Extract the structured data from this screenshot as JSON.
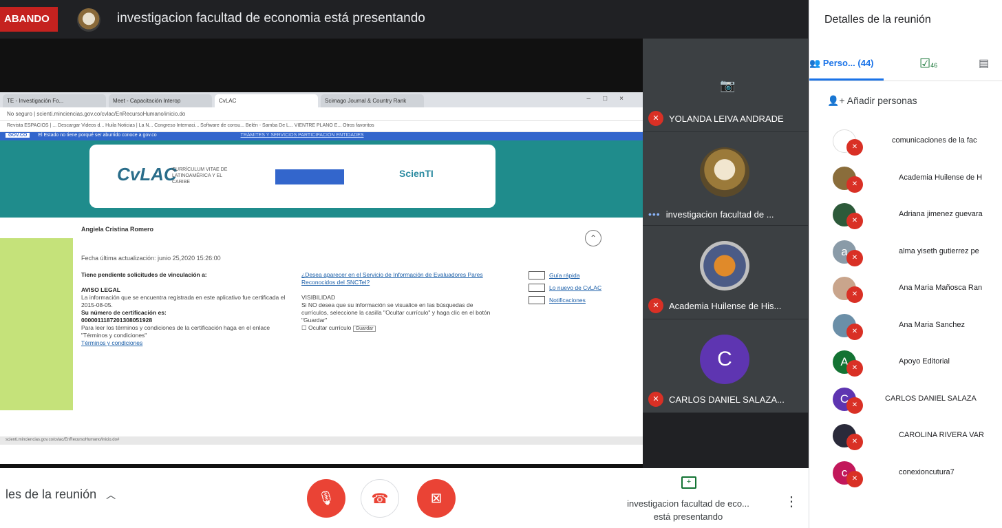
{
  "topbar": {
    "recording_label": "ABANDO",
    "presenter_text": "investigacion facultad de economia está presentando"
  },
  "browser": {
    "tabs": [
      "TE - Investigación Fo...",
      "Meet - Capacitación Interop",
      "CvLAC",
      "Scimago Journal & Country Rank"
    ],
    "address": "No seguro | scienti.minciencias.gov.co/cvlac/EnRecursoHumano/inicio.do",
    "bookmarks": "Revista ESPACIOS | ...  Descargar Videos d...  Huila Noticias | La N...  Congreso Internaci...  Software de consu...  Belén - Samba De L...  VIENTRE PLANO E...  Otros favoritos",
    "gov_label": "GOV.CO",
    "gov_note": "El Estado no tiene porqué ser aburrido conoce a gov.co",
    "gov_links": "TRÁMITES Y SERVICIOS   PARTICIPACIÓN   ENTIDADES",
    "cvlac_logo": "CvLAC",
    "cvlac_sub": "CURRÍCULUM VITAE DE LATINOAMÉRICA Y EL CARIBE",
    "scienti": "ScienTI",
    "person_name": "Angiela Cristina Romero",
    "last_update": "Fecha última actualización: junio 25,2020 15:26:00",
    "pending": "Tiene pendiente solicitudes de vinculación a:",
    "legal_title": "AVISO LEGAL",
    "legal_text": "La información que se encuentra registrada en este aplicativo fue certificada el 2015-08-05.",
    "cert_label": "Su número de certificación es:",
    "cert_number": "0000011187201308051928",
    "terms_text": "Para leer los términos y condiciones de la certificación haga en el enlace \"Términos y condiciones\"",
    "terms_link": "Términos y condiciones",
    "question_link": "¿Desea aparecer en el Servicio de Información de Evaluadores Pares Reconocidos del SNCTeI?",
    "visibility_title": "VISIBILIDAD",
    "visibility_text": "Si NO desea que su información se visualice en las búsquedas de currículos, seleccione la casilla \"Ocultar currículo\" y haga clic en el botón \"Guardar\"",
    "hide_label": "Ocultar currículo",
    "save_btn": "Guardar",
    "quick_guide": "Guía rápida",
    "news": "Lo nuevo de CvLAC",
    "notifications": "Notificaciones",
    "status_url": "scienti.minciencias.gov.co/cvlac/EnRecursoHumano/inicio.do#"
  },
  "tiles": [
    {
      "name": "YOLANDA LEIVA ANDRADE"
    },
    {
      "name": "investigacion facultad de ..."
    },
    {
      "name": "Academia Huilense de His..."
    },
    {
      "name": "CARLOS DANIEL SALAZA...",
      "initial": "C"
    }
  ],
  "bottom": {
    "meeting_details": "les de la reunión",
    "presenting_line1": "investigacion facultad de eco...",
    "presenting_line2": "está presentando"
  },
  "panel": {
    "title": "Detalles de la reunión",
    "people_tab": "Perso... (44)",
    "checks_count": "46",
    "add_people": "Añadir personas",
    "participants": [
      {
        "name": "comunicaciones de la fac",
        "color": "#ffffff"
      },
      {
        "name": "Academia Huilense de H",
        "color": "#8a6d3b"
      },
      {
        "name": "Adriana jimenez guevara",
        "color": "#2d5a3a"
      },
      {
        "name": "alma yiseth gutierrez pe",
        "color": "#8a9ba8",
        "initial": "a"
      },
      {
        "name": "Ana Maria Mañosca Ran",
        "color": "#c9a58c"
      },
      {
        "name": "Ana Maria Sanchez",
        "color": "#6b8fa8"
      },
      {
        "name": "Apoyo Editorial",
        "color": "#137333",
        "initial": "A"
      },
      {
        "name": "CARLOS DANIEL SALAZA",
        "color": "#5e35b1",
        "initial": "C"
      },
      {
        "name": "CAROLINA RIVERA VAR",
        "color": "#2a2a3a"
      },
      {
        "name": "conexioncutura7",
        "color": "#c2185b",
        "initial": "c"
      }
    ]
  },
  "colors": {
    "accent": "#1a73e8",
    "danger": "#d93025"
  }
}
